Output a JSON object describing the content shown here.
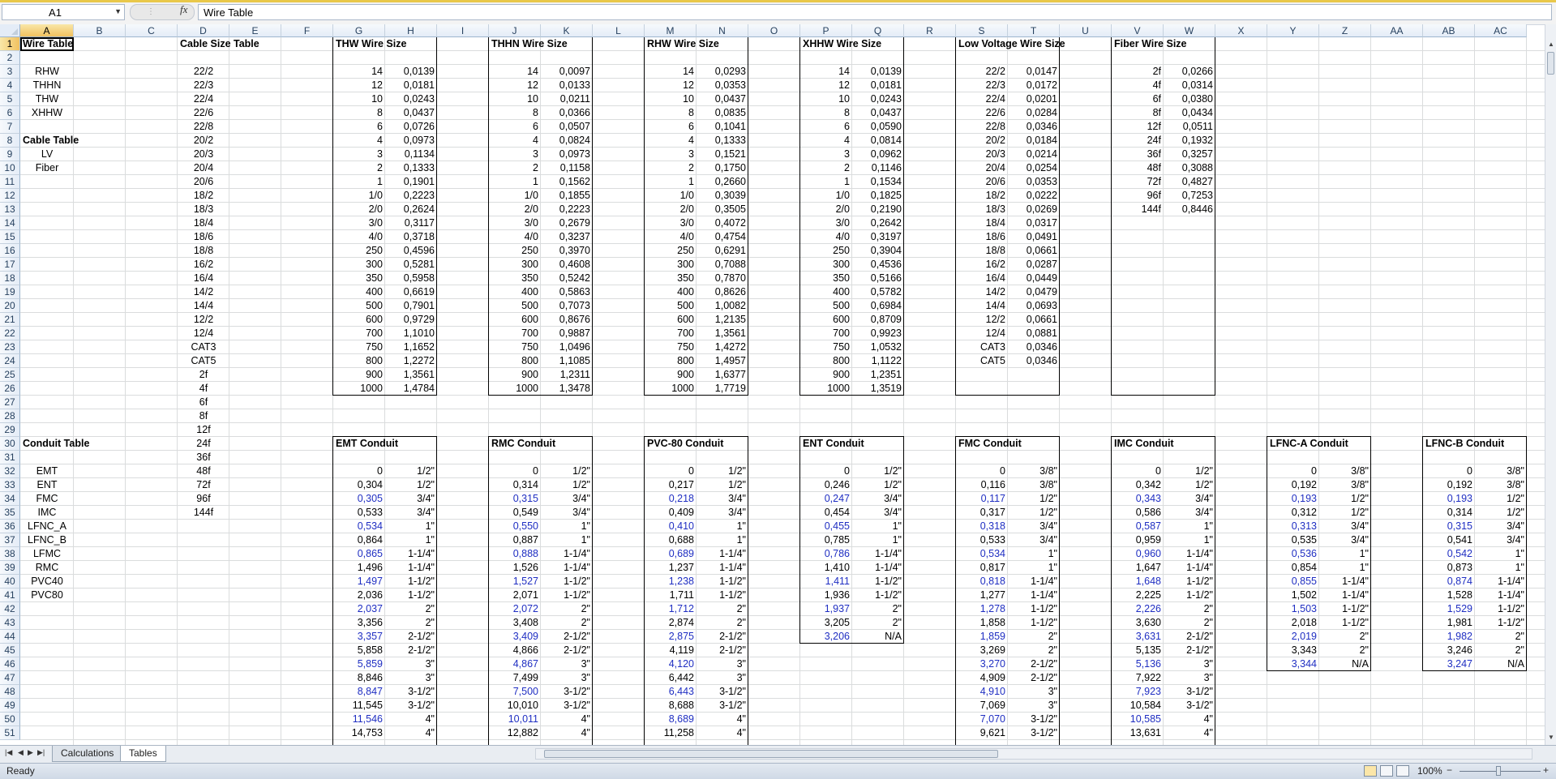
{
  "formula_bar": {
    "name_box": "A1",
    "fx": "fx",
    "formula": "Wire Table"
  },
  "columns": [
    "A",
    "B",
    "C",
    "D",
    "E",
    "F",
    "G",
    "H",
    "I",
    "J",
    "K",
    "L",
    "M",
    "N",
    "O",
    "P",
    "Q",
    "R",
    "S",
    "T",
    "U",
    "V",
    "W",
    "X",
    "Y",
    "Z",
    "AA",
    "AB",
    "AC"
  ],
  "rows": [
    "1",
    "2",
    "3",
    "4",
    "5",
    "6",
    "7",
    "8",
    "9",
    "10",
    "11",
    "12",
    "13",
    "14",
    "15",
    "16",
    "17",
    "18",
    "19",
    "20",
    "21",
    "22",
    "23",
    "24",
    "25",
    "26",
    "27",
    "28",
    "29",
    "30",
    "31",
    "32",
    "33",
    "34",
    "35",
    "36",
    "37",
    "38",
    "39",
    "40",
    "41",
    "42",
    "43",
    "44",
    "45",
    "46",
    "47",
    "48",
    "49",
    "50",
    "51"
  ],
  "col_A": {
    "title": "Wire Table",
    "wire_types": [
      "RHW",
      "THHN",
      "THW",
      "XHHW"
    ],
    "cable_title": "Cable Table",
    "cable_types": [
      "LV",
      "Fiber"
    ],
    "conduit_title": "Conduit Table",
    "conduit_types": [
      "EMT",
      "ENT",
      "FMC",
      "IMC",
      "LFNC_A",
      "LFNC_B",
      "LFMC",
      "RMC",
      "PVC40",
      "PVC80"
    ]
  },
  "col_D": {
    "title": "Cable Size Table",
    "sizes": [
      "22/2",
      "22/3",
      "22/4",
      "22/6",
      "22/8",
      "20/2",
      "20/3",
      "20/4",
      "20/6",
      "18/2",
      "18/3",
      "18/4",
      "18/6",
      "18/8",
      "16/2",
      "16/4",
      "14/2",
      "14/4",
      "12/2",
      "12/4",
      "CAT3",
      "CAT5",
      "2f",
      "4f",
      "6f",
      "8f",
      "12f",
      "24f",
      "36f",
      "48f",
      "72f",
      "96f",
      "144f"
    ]
  },
  "wire_tables": [
    {
      "title": "THW Wire Size",
      "sizes": [
        "14",
        "12",
        "10",
        "8",
        "6",
        "4",
        "3",
        "2",
        "1",
        "1/0",
        "2/0",
        "3/0",
        "4/0",
        "250",
        "300",
        "350",
        "400",
        "500",
        "600",
        "700",
        "750",
        "800",
        "900",
        "1000"
      ],
      "values": [
        "0,0139",
        "0,0181",
        "0,0243",
        "0,0437",
        "0,0726",
        "0,0973",
        "0,1134",
        "0,1333",
        "0,1901",
        "0,2223",
        "0,2624",
        "0,3117",
        "0,3718",
        "0,4596",
        "0,5281",
        "0,5958",
        "0,6619",
        "0,7901",
        "0,9729",
        "1,1010",
        "1,1652",
        "1,2272",
        "1,3561",
        "1,4784"
      ]
    },
    {
      "title": "THHN Wire Size",
      "sizes": [
        "14",
        "12",
        "10",
        "8",
        "6",
        "4",
        "3",
        "2",
        "1",
        "1/0",
        "2/0",
        "3/0",
        "4/0",
        "250",
        "300",
        "350",
        "400",
        "500",
        "600",
        "700",
        "750",
        "800",
        "900",
        "1000"
      ],
      "values": [
        "0,0097",
        "0,0133",
        "0,0211",
        "0,0366",
        "0,0507",
        "0,0824",
        "0,0973",
        "0,1158",
        "0,1562",
        "0,1855",
        "0,2223",
        "0,2679",
        "0,3237",
        "0,3970",
        "0,4608",
        "0,5242",
        "0,5863",
        "0,7073",
        "0,8676",
        "0,9887",
        "1,0496",
        "1,1085",
        "1,2311",
        "1,3478"
      ]
    },
    {
      "title": "RHW Wire Size",
      "sizes": [
        "14",
        "12",
        "10",
        "8",
        "6",
        "4",
        "3",
        "2",
        "1",
        "1/0",
        "2/0",
        "3/0",
        "4/0",
        "250",
        "300",
        "350",
        "400",
        "500",
        "600",
        "700",
        "750",
        "800",
        "900",
        "1000"
      ],
      "values": [
        "0,0293",
        "0,0353",
        "0,0437",
        "0,0835",
        "0,1041",
        "0,1333",
        "0,1521",
        "0,1750",
        "0,2660",
        "0,3039",
        "0,3505",
        "0,4072",
        "0,4754",
        "0,6291",
        "0,7088",
        "0,7870",
        "0,8626",
        "1,0082",
        "1,2135",
        "1,3561",
        "1,4272",
        "1,4957",
        "1,6377",
        "1,7719"
      ]
    },
    {
      "title": "XHHW Wire Size",
      "sizes": [
        "14",
        "12",
        "10",
        "8",
        "6",
        "4",
        "3",
        "2",
        "1",
        "1/0",
        "2/0",
        "3/0",
        "4/0",
        "250",
        "300",
        "350",
        "400",
        "500",
        "600",
        "700",
        "750",
        "800",
        "900",
        "1000"
      ],
      "values": [
        "0,0139",
        "0,0181",
        "0,0243",
        "0,0437",
        "0,0590",
        "0,0814",
        "0,0962",
        "0,1146",
        "0,1534",
        "0,1825",
        "0,2190",
        "0,2642",
        "0,3197",
        "0,3904",
        "0,4536",
        "0,5166",
        "0,5782",
        "0,6984",
        "0,8709",
        "0,9923",
        "1,0532",
        "1,1122",
        "1,2351",
        "1,3519"
      ]
    },
    {
      "title": "Low Voltage Wire Size",
      "sizes": [
        "22/2",
        "22/3",
        "22/4",
        "22/6",
        "22/8",
        "20/2",
        "20/3",
        "20/4",
        "20/6",
        "18/2",
        "18/3",
        "18/4",
        "18/6",
        "18/8",
        "16/2",
        "16/4",
        "14/2",
        "14/4",
        "12/2",
        "12/4",
        "CAT3",
        "CAT5"
      ],
      "values": [
        "0,0147",
        "0,0172",
        "0,0201",
        "0,0284",
        "0,0346",
        "0,0184",
        "0,0214",
        "0,0254",
        "0,0353",
        "0,0222",
        "0,0269",
        "0,0317",
        "0,0491",
        "0,0661",
        "0,0287",
        "0,0449",
        "0,0479",
        "0,0693",
        "0,0661",
        "0,0881",
        "0,0346",
        "0,0346"
      ]
    },
    {
      "title": "Fiber Wire Size",
      "sizes": [
        "2f",
        "4f",
        "6f",
        "8f",
        "12f",
        "24f",
        "36f",
        "48f",
        "72f",
        "96f",
        "144f"
      ],
      "values": [
        "0,0266",
        "0,0314",
        "0,0380",
        "0,0434",
        "0,0511",
        "0,1932",
        "0,3257",
        "0,3088",
        "0,4827",
        "0,7253",
        "0,8446"
      ]
    }
  ],
  "conduit_tables": [
    {
      "title": "EMT Conduit",
      "values": [
        "0",
        "0,304",
        "0,305",
        "0,533",
        "0,534",
        "0,864",
        "0,865",
        "1,496",
        "1,497",
        "2,036",
        "2,037",
        "3,356",
        "3,357",
        "5,858",
        "5,859",
        "8,846",
        "8,847",
        "11,545",
        "11,546",
        "14,753"
      ],
      "sizes": [
        "1/2\"",
        "1/2\"",
        "3/4\"",
        "3/4\"",
        "1\"",
        "1\"",
        "1-1/4\"",
        "1-1/4\"",
        "1-1/2\"",
        "1-1/2\"",
        "2\"",
        "2\"",
        "2-1/2\"",
        "2-1/2\"",
        "3\"",
        "3\"",
        "3-1/2\"",
        "3-1/2\"",
        "4\"",
        "4\""
      ]
    },
    {
      "title": "RMC Conduit",
      "values": [
        "0",
        "0,314",
        "0,315",
        "0,549",
        "0,550",
        "0,887",
        "0,888",
        "1,526",
        "1,527",
        "2,071",
        "2,072",
        "3,408",
        "3,409",
        "4,866",
        "4,867",
        "7,499",
        "7,500",
        "10,010",
        "10,011",
        "12,882"
      ],
      "sizes": [
        "1/2\"",
        "1/2\"",
        "3/4\"",
        "3/4\"",
        "1\"",
        "1\"",
        "1-1/4\"",
        "1-1/4\"",
        "1-1/2\"",
        "1-1/2\"",
        "2\"",
        "2\"",
        "2-1/2\"",
        "2-1/2\"",
        "3\"",
        "3\"",
        "3-1/2\"",
        "3-1/2\"",
        "4\"",
        "4\""
      ]
    },
    {
      "title": "PVC-80 Conduit",
      "values": [
        "0",
        "0,217",
        "0,218",
        "0,409",
        "0,410",
        "0,688",
        "0,689",
        "1,237",
        "1,238",
        "1,711",
        "1,712",
        "2,874",
        "2,875",
        "4,119",
        "4,120",
        "6,442",
        "6,443",
        "8,688",
        "8,689",
        "11,258"
      ],
      "sizes": [
        "1/2\"",
        "1/2\"",
        "3/4\"",
        "3/4\"",
        "1\"",
        "1\"",
        "1-1/4\"",
        "1-1/4\"",
        "1-1/2\"",
        "1-1/2\"",
        "2\"",
        "2\"",
        "2-1/2\"",
        "2-1/2\"",
        "3\"",
        "3\"",
        "3-1/2\"",
        "3-1/2\"",
        "4\"",
        "4\""
      ]
    },
    {
      "title": "ENT Conduit",
      "values": [
        "0",
        "0,246",
        "0,247",
        "0,454",
        "0,455",
        "0,785",
        "0,786",
        "1,410",
        "1,411",
        "1,936",
        "1,937",
        "3,205",
        "3,206"
      ],
      "sizes": [
        "1/2\"",
        "1/2\"",
        "3/4\"",
        "3/4\"",
        "1\"",
        "1\"",
        "1-1/4\"",
        "1-1/4\"",
        "1-1/2\"",
        "1-1/2\"",
        "2\"",
        "2\"",
        "N/A"
      ]
    },
    {
      "title": "FMC Conduit",
      "values": [
        "0",
        "0,116",
        "0,117",
        "0,317",
        "0,318",
        "0,533",
        "0,534",
        "0,817",
        "0,818",
        "1,277",
        "1,278",
        "1,858",
        "1,859",
        "3,269",
        "3,270",
        "4,909",
        "4,910",
        "7,069",
        "7,070",
        "9,621"
      ],
      "sizes": [
        "3/8\"",
        "3/8\"",
        "1/2\"",
        "1/2\"",
        "3/4\"",
        "3/4\"",
        "1\"",
        "1\"",
        "1-1/4\"",
        "1-1/4\"",
        "1-1/2\"",
        "1-1/2\"",
        "2\"",
        "2\"",
        "2-1/2\"",
        "2-1/2\"",
        "3\"",
        "3\"",
        "3-1/2\"",
        "3-1/2\""
      ]
    },
    {
      "title": "IMC Conduit",
      "values": [
        "0",
        "0,342",
        "0,343",
        "0,586",
        "0,587",
        "0,959",
        "0,960",
        "1,647",
        "1,648",
        "2,225",
        "2,226",
        "3,630",
        "3,631",
        "5,135",
        "5,136",
        "7,922",
        "7,923",
        "10,584",
        "10,585",
        "13,631"
      ],
      "sizes": [
        "1/2\"",
        "1/2\"",
        "3/4\"",
        "3/4\"",
        "1\"",
        "1\"",
        "1-1/4\"",
        "1-1/4\"",
        "1-1/2\"",
        "1-1/2\"",
        "2\"",
        "2\"",
        "2-1/2\"",
        "2-1/2\"",
        "3\"",
        "3\"",
        "3-1/2\"",
        "3-1/2\"",
        "4\"",
        "4\""
      ]
    },
    {
      "title": "LFNC-A Conduit",
      "values": [
        "0",
        "0,192",
        "0,193",
        "0,312",
        "0,313",
        "0,535",
        "0,536",
        "0,854",
        "0,855",
        "1,502",
        "1,503",
        "2,018",
        "2,019",
        "3,343",
        "3,344"
      ],
      "sizes": [
        "3/8\"",
        "3/8\"",
        "1/2\"",
        "1/2\"",
        "3/4\"",
        "3/4\"",
        "1\"",
        "1\"",
        "1-1/4\"",
        "1-1/4\"",
        "1-1/2\"",
        "1-1/2\"",
        "2\"",
        "2\"",
        "N/A"
      ]
    },
    {
      "title": "LFNC-B Conduit",
      "values": [
        "0",
        "0,192",
        "0,193",
        "0,314",
        "0,315",
        "0,541",
        "0,542",
        "0,873",
        "0,874",
        "1,528",
        "1,529",
        "1,981",
        "1,982",
        "3,246",
        "3,247"
      ],
      "sizes": [
        "3/8\"",
        "3/8\"",
        "1/2\"",
        "1/2\"",
        "3/4\"",
        "3/4\"",
        "1\"",
        "1\"",
        "1-1/4\"",
        "1-1/4\"",
        "1-1/2\"",
        "1-1/2\"",
        "2\"",
        "2\"",
        "N/A"
      ]
    }
  ],
  "colors": {
    "highlight_value": "#1f2ec2",
    "header_selected": "#f1c15f",
    "grid": "#dadcdd"
  },
  "sheet_tabs": [
    "Calculations",
    "Tables"
  ],
  "active_tab": "Tables",
  "status": {
    "text": "Ready",
    "zoom": "100%",
    "zoom_minus": "−",
    "zoom_plus": "+"
  },
  "icons": {
    "name_box_arrow": "chevron-down-icon",
    "fx": "function-icon",
    "tab_nav": "tab-navigation-arrows",
    "view_buttons": "normal-layout-pagebreak-view-icons"
  }
}
